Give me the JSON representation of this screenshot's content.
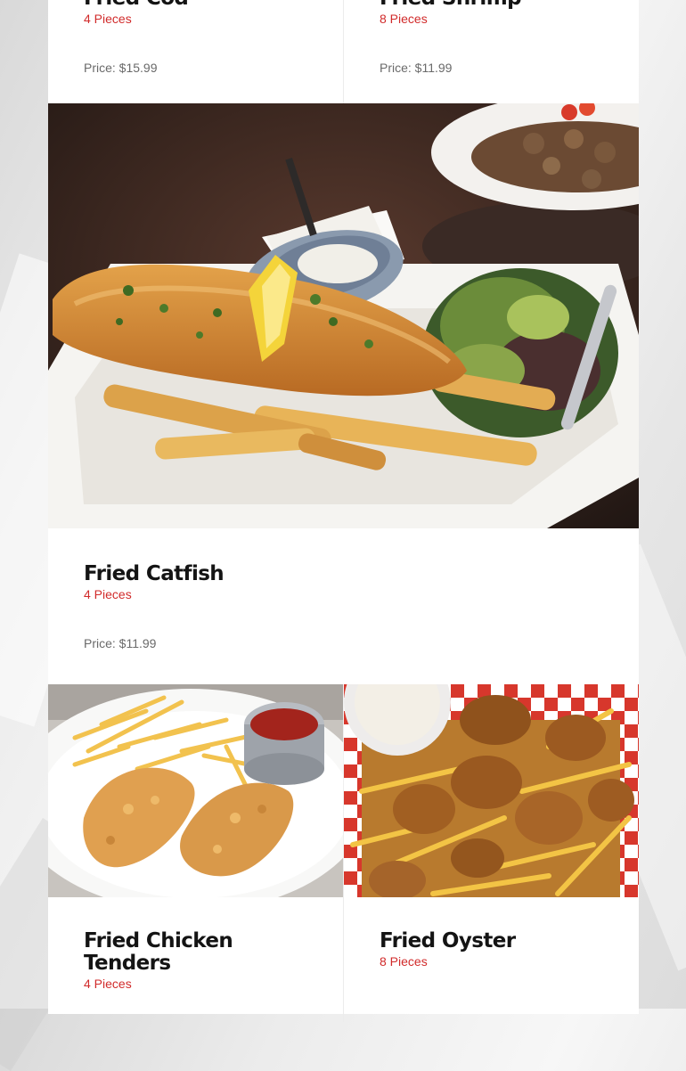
{
  "menu": {
    "items": [
      {
        "title": "Fried Cod",
        "pieces": "4 Pieces",
        "price": "Price: $15.99"
      },
      {
        "title": "Fried Shrimp",
        "pieces": "8 Pieces",
        "price": "Price: $11.99"
      },
      {
        "title": "Fried Catfish",
        "pieces": "4 Pieces",
        "price": "Price: $11.99",
        "image": "fish-and-chips-photo"
      },
      {
        "title": "Fried Chicken Tenders",
        "pieces": "4 Pieces",
        "image": "chicken-tenders-photo"
      },
      {
        "title": "Fried Oyster",
        "pieces": "8 Pieces",
        "image": "fried-oyster-photo"
      }
    ]
  },
  "colors": {
    "accent": "#d12b2b",
    "title": "#141414",
    "price": "#6a6a6a"
  }
}
